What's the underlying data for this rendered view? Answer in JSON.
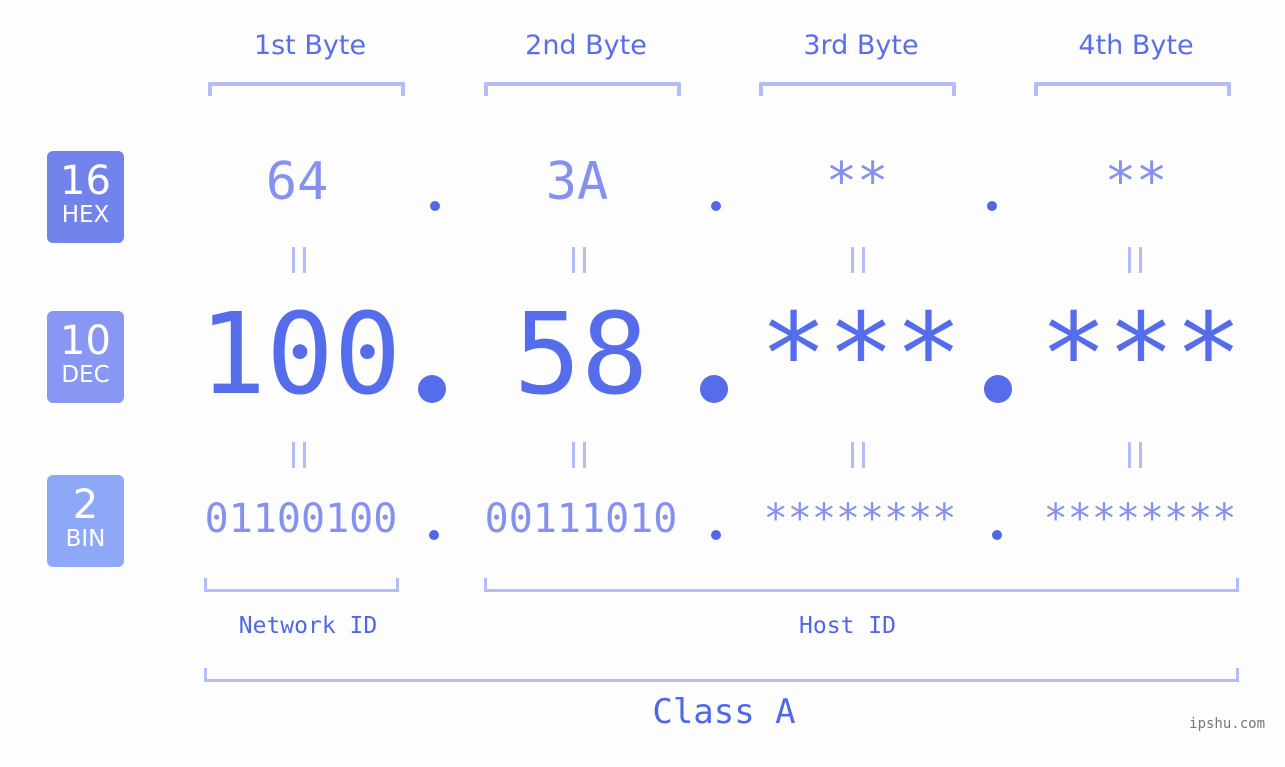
{
  "bytes": [
    "1st Byte",
    "2nd Byte",
    "3rd Byte",
    "4th Byte"
  ],
  "badges": {
    "hex": {
      "num": "16",
      "label": "HEX",
      "color": "#7383ec"
    },
    "dec": {
      "num": "10",
      "label": "DEC",
      "color": "#8898f2"
    },
    "bin": {
      "num": "2",
      "label": "BIN",
      "color": "#8ea8f8"
    }
  },
  "hex_values": [
    "64",
    "3A",
    "**",
    "**"
  ],
  "dec_values": [
    "100",
    "58",
    "***",
    "***"
  ],
  "bin_values": [
    "01100100",
    "00111010",
    "********",
    "********"
  ],
  "network_id_label": "Network ID",
  "host_id_label": "Host ID",
  "class_label": "Class A",
  "watermark": "ipshu.com",
  "colors": {
    "primary": "#556ceb",
    "light": "#8591ef",
    "bracket": "#b3bdf8"
  }
}
